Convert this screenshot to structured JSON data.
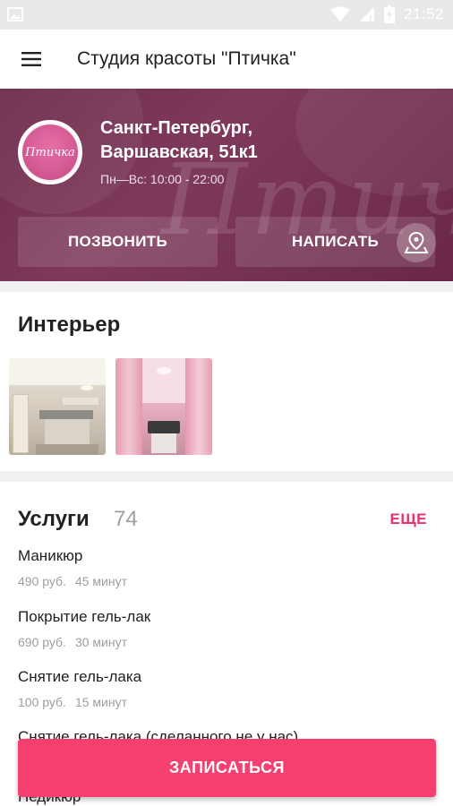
{
  "status_bar": {
    "time": "21:52"
  },
  "app_bar": {
    "title": "Студия красоты \"Птичка\""
  },
  "salon": {
    "logo_text": "Птичка",
    "address_line1": "Санкт-Петербург,",
    "address_line2": "Варшавская, 51к1",
    "hours": "Пн—Вс: 10:00 - 22:00",
    "call_label": "ПОЗВОНИТЬ",
    "write_label": "НАПИСАТЬ"
  },
  "interior": {
    "title": "Интерьер"
  },
  "services": {
    "title": "Услуги",
    "count": "74",
    "more_label": "ЕЩЕ",
    "items": [
      {
        "name": "Маникюр",
        "price": "490 руб.",
        "duration": "45 минут"
      },
      {
        "name": "Покрытие гель-лак",
        "price": "690 руб.",
        "duration": "30 минут"
      },
      {
        "name": "Снятие гель-лака",
        "price": "100 руб.",
        "duration": "15 минут"
      },
      {
        "name": "Снятие гель-лака (сделанного не у нас)"
      },
      {
        "name": "Педикюр"
      }
    ]
  },
  "cta": {
    "label": "ЗАПИСАТЬСЯ"
  },
  "colors": {
    "accent": "#f43f6f",
    "banner": "#7a3556",
    "link": "#e8326a"
  }
}
